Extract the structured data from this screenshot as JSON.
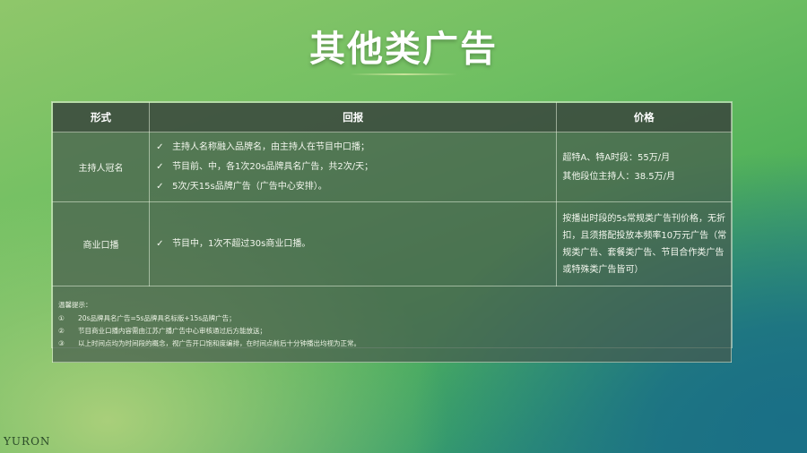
{
  "title": "其他类广告",
  "table": {
    "headers": [
      "形式",
      "回报",
      "价格"
    ],
    "rows": [
      {
        "form": "主持人冠名",
        "returns": [
          "主持人名称融入品牌名，由主持人在节目中口播；",
          "节目前、中，各1次20s品牌具名广告，共2次/天；",
          "5次/天15s品牌广告（广告中心安排）。"
        ],
        "price": [
          "超特A、特A时段：55万/月",
          "其他段位主持人：38.5万/月"
        ]
      },
      {
        "form": "商业口播",
        "returns": [
          "节目中，1次不超过30s商业口播。"
        ],
        "price": [
          "按播出时段的5s常规类广告刊价格，无折扣，且须搭配投放本频率10万元广告（常规类广告、套餐类广告、节目合作类广告或特殊类广告皆可）"
        ]
      }
    ],
    "check_icon": "✓"
  },
  "notes": {
    "title": "温馨提示：",
    "items": [
      {
        "num": "①",
        "text": "20s品牌具名广告=5s品牌具名标版+15s品牌广告；"
      },
      {
        "num": "②",
        "text": "节目商业口播内容需由江苏广播广告中心审核通过后方能放送；"
      },
      {
        "num": "③",
        "text": "以上时间点均为时间段的概念，视广告开口饱和度编排，在时间点前后十分钟播出均视为正常。"
      }
    ]
  },
  "brand": "YURON"
}
